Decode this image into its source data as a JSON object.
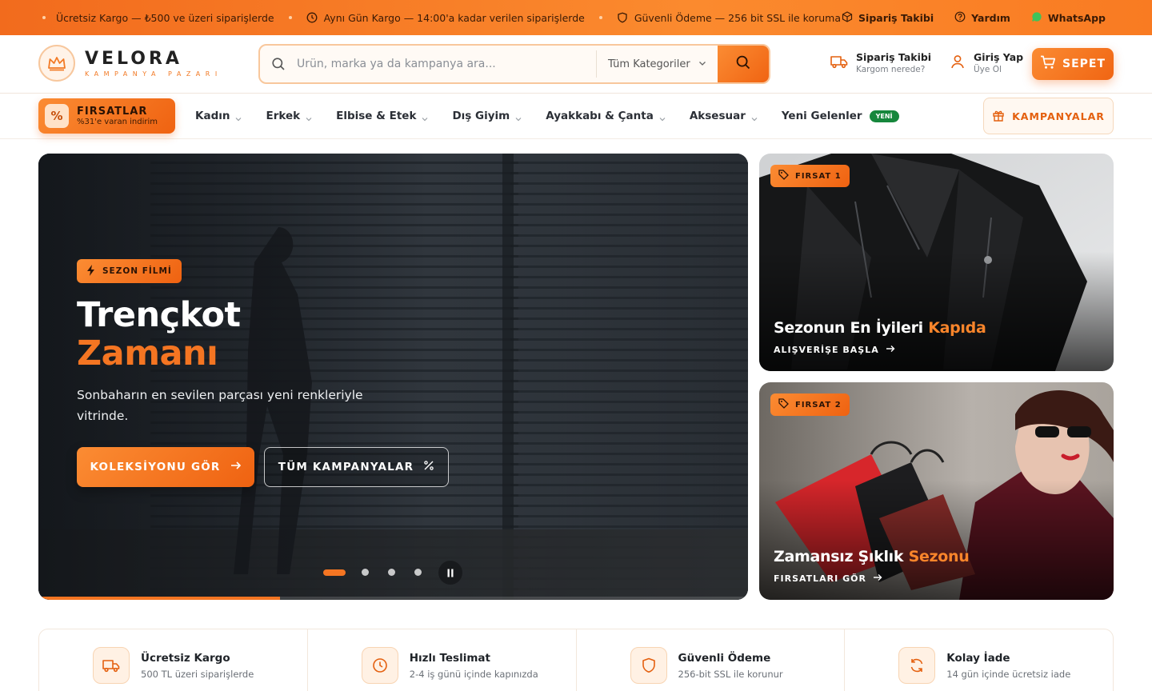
{
  "topbar": {
    "messages": [
      "Ücretsiz Kargo — ₺500 ve üzeri siparişlerde",
      "Aynı Gün Kargo — 14:00'a kadar verilen siparişlerde",
      "Güvenli Ödeme — 256 bit SSL ile koruma"
    ],
    "links": {
      "order_tracking": "Sipariş Takibi",
      "help": "Yardım",
      "whatsapp": "WhatsApp"
    }
  },
  "brand": {
    "name": "VELORA",
    "tagline": "KAMPANYA PAZARI"
  },
  "search": {
    "placeholder": "Ürün, marka ya da kampanya ara...",
    "category": "Tüm Kategoriler"
  },
  "header": {
    "track_title": "Sipariş Takibi",
    "track_sub": "Kargom nerede?",
    "login_title": "Giriş Yap",
    "login_sub": "Üye Ol",
    "cart_label": "SEPET"
  },
  "nav": {
    "deals_title": "FIRSATLAR",
    "deals_sub": "%31'e varan indirim",
    "items": [
      "Kadın",
      "Erkek",
      "Elbise & Etek",
      "Dış Giyim",
      "Ayakkabı & Çanta",
      "Aksesuar",
      "Yeni Gelenler"
    ],
    "new_badge": "YENİ",
    "campaigns_label": "KAMPANYALAR"
  },
  "hero": {
    "tag": "SEZON FİLMİ",
    "title_line1": "Trençkot",
    "title_line2": "Zamanı",
    "description": "Sonbaharın en sevilen parçası yeni renkleriyle vitrinde.",
    "primary_cta": "KOLEKSİYONU GÖR",
    "secondary_cta": "TÜM KAMPANYALAR",
    "slide_count": 4,
    "active_slide": 1,
    "progress": 0.34
  },
  "promos": [
    {
      "tag": "FIRSAT 1",
      "title_main": "Sezonun En İyileri",
      "title_accent": "Kapıda",
      "cta": "ALIŞVERİŞE BAŞLA"
    },
    {
      "tag": "FIRSAT 2",
      "title_main": "Zamansız Şıklık",
      "title_accent": "Sezonu",
      "cta": "FIRSATLARI GÖR"
    }
  ],
  "features": [
    {
      "icon": "truck-icon",
      "title": "Ücretsiz Kargo",
      "sub": "500 TL üzeri siparişlerde"
    },
    {
      "icon": "clock-icon",
      "title": "Hızlı Teslimat",
      "sub": "2-4 iş günü içinde kapınızda"
    },
    {
      "icon": "shield-icon",
      "title": "Güvenli Ödeme",
      "sub": "256-bit SSL ile korunur"
    },
    {
      "icon": "refresh-icon",
      "title": "Kolay İade",
      "sub": "14 gün içinde ücretsiz iade"
    }
  ],
  "colors": {
    "accent": "#f47522",
    "accent_dark": "#ef6211",
    "new_badge": "#16873c"
  }
}
